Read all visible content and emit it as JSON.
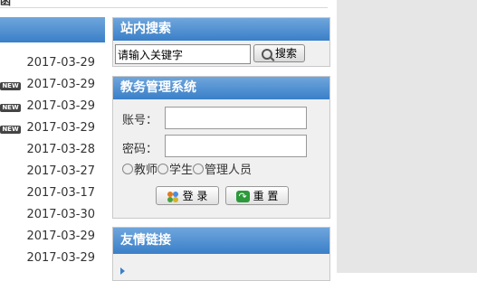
{
  "header": {
    "partial_title": "函"
  },
  "news": {
    "items": [
      {
        "new": false,
        "date": "2017-03-29"
      },
      {
        "new": true,
        "date": "2017-03-29"
      },
      {
        "new": true,
        "date": "2017-03-29"
      },
      {
        "new": true,
        "date": "2017-03-29"
      },
      {
        "new": false,
        "date": "2017-03-28"
      },
      {
        "new": false,
        "date": "2017-03-27"
      },
      {
        "new": false,
        "date": "2017-03-17"
      },
      {
        "new": false,
        "date": "2017-03-30"
      },
      {
        "new": false,
        "date": "2017-03-29"
      },
      {
        "new": false,
        "date": "2017-03-29"
      }
    ],
    "badge": "NEW"
  },
  "search": {
    "title": "站内搜索",
    "input_value": "请输入关键字",
    "button_label": "搜索"
  },
  "login": {
    "title": "教务管理系统",
    "account_label": "账号：",
    "password_label": "密码：",
    "roles": [
      "教师",
      "学生",
      "管理人员"
    ],
    "login_button": "登 录",
    "reset_button": "重 置"
  },
  "links": {
    "title": "友情链接"
  },
  "colors": {
    "header_blue": "#3a7fc8",
    "panel_bg": "#f0f0f0",
    "side_gray": "#e6e6e6"
  }
}
